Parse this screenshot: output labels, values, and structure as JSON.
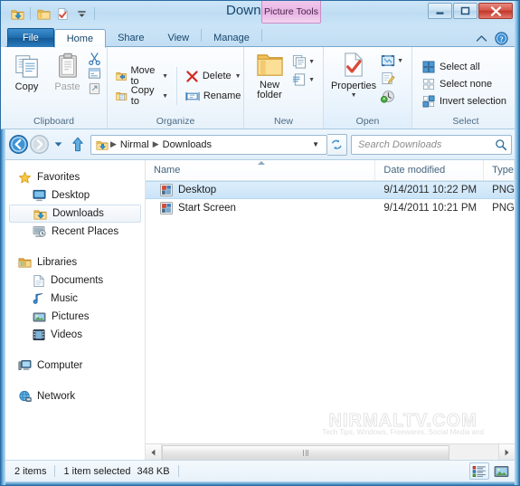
{
  "window": {
    "title": "Downloads",
    "contextual_tools": "Picture Tools",
    "buttons": {
      "minimize": "Minimize",
      "restore": "Restore",
      "close": "Close"
    },
    "quick_access": [
      {
        "name": "downloads-folder",
        "label": "Downloads"
      },
      {
        "name": "properties",
        "label": "Properties"
      },
      {
        "name": "customize",
        "label": "Customize Quick Access Toolbar"
      }
    ]
  },
  "tabs": [
    {
      "label": "File",
      "kind": "file"
    },
    {
      "label": "Home",
      "kind": "active"
    },
    {
      "label": "Share",
      "kind": "normal"
    },
    {
      "label": "View",
      "kind": "normal"
    },
    {
      "label": "Manage",
      "kind": "contextual"
    }
  ],
  "tabstrip_right": {
    "collapse_ribbon": "Minimize the Ribbon",
    "help": "Help"
  },
  "ribbon": {
    "groups": [
      {
        "label": "Clipboard",
        "big_buttons": [
          {
            "label": "Copy",
            "icon": "copy-icon",
            "disabled": false
          },
          {
            "label": "Paste",
            "icon": "paste-icon",
            "disabled": true
          }
        ],
        "small_icons": [
          {
            "label": "Cut",
            "icon": "cut-icon"
          },
          {
            "label": "Copy path",
            "icon": "copy-path-icon"
          },
          {
            "label": "Paste shortcut",
            "icon": "paste-shortcut-icon"
          }
        ]
      },
      {
        "label": "Organize",
        "rows": [
          {
            "label": "Move to",
            "icon": "move-to-icon",
            "has_caret": true
          },
          {
            "label": "Copy to",
            "icon": "copy-to-icon",
            "has_caret": true
          },
          {
            "label": "Delete",
            "icon": "delete-icon",
            "has_caret": true
          },
          {
            "label": "Rename",
            "icon": "rename-icon",
            "has_caret": false
          }
        ]
      },
      {
        "label": "New",
        "big_buttons": [
          {
            "label": "New folder",
            "icon": "new-folder-icon"
          }
        ],
        "small_icons": [
          {
            "label": "New item",
            "icon": "new-item-icon"
          },
          {
            "label": "Easy access",
            "icon": "easy-access-icon"
          }
        ]
      },
      {
        "label": "Open",
        "big_buttons": [
          {
            "label": "Properties",
            "icon": "properties-icon"
          }
        ],
        "small_icons": [
          {
            "label": "Open",
            "icon": "open-icon"
          },
          {
            "label": "Edit",
            "icon": "edit-icon"
          },
          {
            "label": "History",
            "icon": "history-icon"
          }
        ]
      },
      {
        "label": "Select",
        "rows": [
          {
            "label": "Select all",
            "icon": "select-all-icon"
          },
          {
            "label": "Select none",
            "icon": "select-none-icon"
          },
          {
            "label": "Invert selection",
            "icon": "invert-selection-icon"
          }
        ]
      }
    ]
  },
  "addressbar": {
    "back": "Back",
    "forward": "Forward",
    "recent": "Recent locations",
    "up": "Up to Nirmal",
    "breadcrumbs": [
      "Nirmal",
      "Downloads"
    ],
    "dropdown": "Previous locations",
    "refresh": "Refresh",
    "search": {
      "placeholder": "Search Downloads",
      "value": "",
      "icon": "search-icon"
    }
  },
  "navpane": {
    "sections": [
      {
        "header": {
          "label": "Favorites",
          "icon": "star-icon"
        },
        "items": [
          {
            "label": "Desktop",
            "icon": "desktop-icon",
            "selected": false
          },
          {
            "label": "Downloads",
            "icon": "downloads-icon",
            "selected": true
          },
          {
            "label": "Recent Places",
            "icon": "recent-places-icon",
            "selected": false
          }
        ]
      },
      {
        "header": {
          "label": "Libraries",
          "icon": "libraries-icon"
        },
        "items": [
          {
            "label": "Documents",
            "icon": "documents-icon",
            "selected": false
          },
          {
            "label": "Music",
            "icon": "music-icon",
            "selected": false
          },
          {
            "label": "Pictures",
            "icon": "pictures-icon",
            "selected": false
          },
          {
            "label": "Videos",
            "icon": "videos-icon",
            "selected": false
          }
        ]
      },
      {
        "header": {
          "label": "Computer",
          "icon": "computer-icon"
        },
        "items": []
      },
      {
        "header": {
          "label": "Network",
          "icon": "network-icon"
        },
        "items": []
      }
    ]
  },
  "filelist": {
    "columns": [
      {
        "label": "Name",
        "sorted": true
      },
      {
        "label": "Date modified",
        "sorted": false
      },
      {
        "label": "Type",
        "sorted": false
      }
    ],
    "rows": [
      {
        "name": "Desktop",
        "date_modified": "9/14/2011 10:22 PM",
        "type": "PNG",
        "icon": "png-file-icon",
        "selected": true
      },
      {
        "name": "Start Screen",
        "date_modified": "9/14/2011 10:21 PM",
        "type": "PNG",
        "icon": "png-file-icon",
        "selected": false
      }
    ]
  },
  "watermark": {
    "main": "NIRMALTV.COM",
    "sub": "Tech Tips, Windows, Freewares, Social Media and"
  },
  "statusbar": {
    "item_count": "2 items",
    "selection": "1 item selected",
    "size": "348 KB",
    "views": [
      {
        "name": "details-view-button",
        "label": "Details view",
        "active": true
      },
      {
        "name": "large-icons-view-button",
        "label": "Large icons view",
        "active": false
      }
    ]
  },
  "colors": {
    "accent": "#2f7cb5",
    "contextual_tab": "#e8b3e4",
    "selection": "#cbe4f8",
    "close_button": "#c0392b"
  }
}
